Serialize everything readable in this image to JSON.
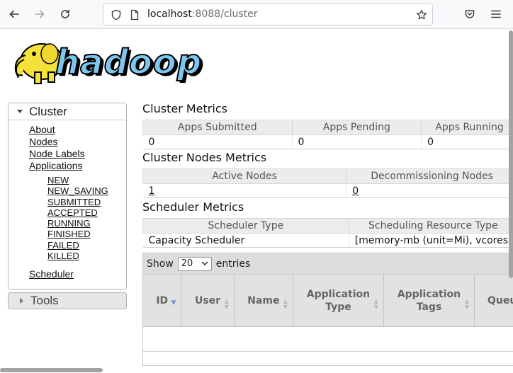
{
  "browser": {
    "url_host": "localhost",
    "url_rest": ":8088/cluster"
  },
  "logo": {
    "text": "hadoop"
  },
  "sidebar": {
    "cluster_title": "Cluster",
    "links": [
      "About",
      "Nodes",
      "Node Labels",
      "Applications"
    ],
    "app_states": [
      "NEW",
      "NEW_SAVING",
      "SUBMITTED",
      "ACCEPTED",
      "RUNNING",
      "FINISHED",
      "FAILED",
      "KILLED"
    ],
    "scheduler_link": "Scheduler",
    "tools_title": "Tools"
  },
  "cluster_metrics": {
    "title": "Cluster Metrics",
    "headers": [
      "Apps Submitted",
      "Apps Pending",
      "Apps Running"
    ],
    "values": [
      "0",
      "0",
      "0"
    ]
  },
  "nodes_metrics": {
    "title": "Cluster Nodes Metrics",
    "headers": [
      "Active Nodes",
      "Decommissioning Nodes"
    ],
    "values": [
      "1",
      "0"
    ]
  },
  "scheduler_metrics": {
    "title": "Scheduler Metrics",
    "headers": [
      "Scheduler Type",
      "Scheduling Resource Type"
    ],
    "values": [
      "Capacity Scheduler",
      "[memory-mb (unit=Mi), vcores]"
    ]
  },
  "apps_table": {
    "show_label": "Show",
    "page_size": "20",
    "entries_label": "entries",
    "columns": [
      "ID",
      "User",
      "Name",
      "Application Type",
      "Application Tags",
      "Queue"
    ]
  },
  "colors": {
    "logo_blue": "#7cc6f0",
    "elephant_yellow": "#f4e23a",
    "sort_active": "#7b8fd6"
  }
}
